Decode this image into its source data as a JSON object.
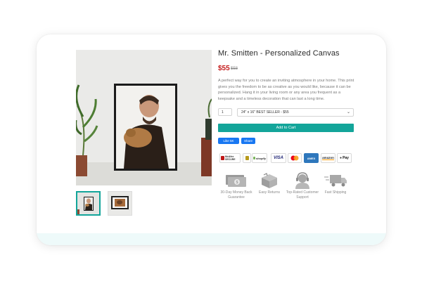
{
  "product": {
    "title": "Mr. Smitten - Personalized Canvas",
    "price": "$55",
    "old_price": "$58",
    "description": "A perfect way for you to create an inviting atmosphere in your home. This print gives you the freedom to be as creative as you would like, because it can be personalized. Hang it in your living room or any area you frequent as a keepsake and a timeless decoration that can last a long time.",
    "quantity": "1",
    "variant_selected": "24\" x 16\" BEST SELLER - $55",
    "add_to_cart_label": "Add to Cart"
  },
  "social": {
    "like_label": "Like 5K",
    "share_label": "Share"
  },
  "badges": {
    "security": [
      {
        "label": "McAfee SECURE",
        "icon": "mcafee-icon"
      },
      {
        "label": "",
        "icon": "lock-icon"
      },
      {
        "label": "shopify",
        "icon": "shopify-icon"
      }
    ],
    "payments": [
      {
        "label": "VISA",
        "icon": "visa-icon",
        "color": "#1a1f71"
      },
      {
        "label": "",
        "icon": "mastercard-icon"
      },
      {
        "label": "AMEX",
        "icon": "amex-icon",
        "color": "#2e77bc"
      },
      {
        "label": "amazon",
        "icon": "amazon-icon"
      },
      {
        "label": "Pay",
        "icon": "apple-pay-icon"
      }
    ]
  },
  "trust": [
    {
      "label": "30-Day Money Back Guarantee",
      "icon": "money-icon"
    },
    {
      "label": "Easy Returns",
      "icon": "box-icon"
    },
    {
      "label": "Top-Rated Customer Support",
      "icon": "support-icon"
    },
    {
      "label": "Fast Shipping",
      "icon": "truck-icon"
    }
  ],
  "colors": {
    "accent": "#13a59a",
    "price": "#c41c1c",
    "facebook": "#1877f2"
  }
}
